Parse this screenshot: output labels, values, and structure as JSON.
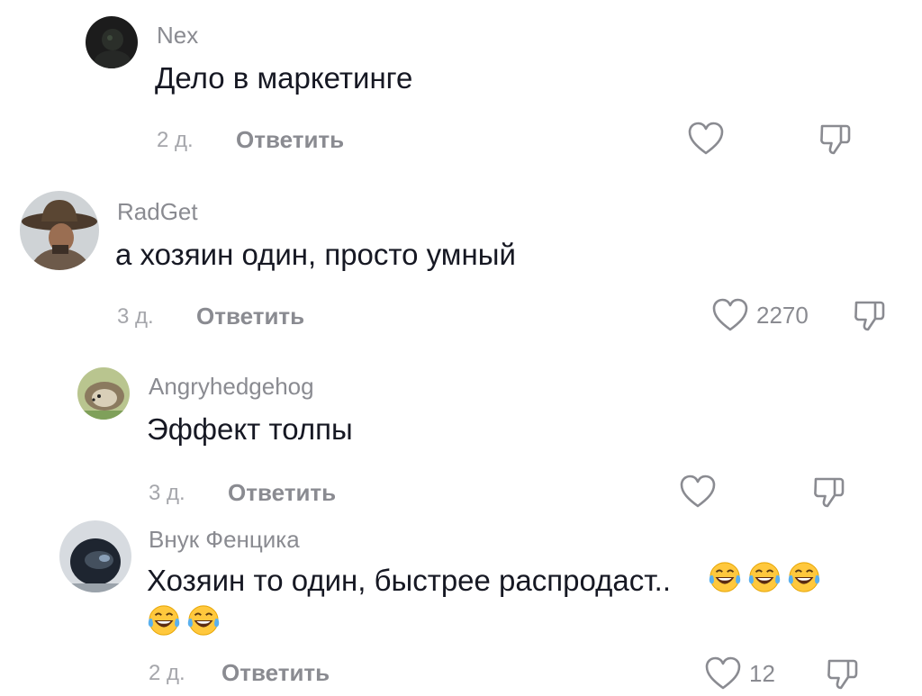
{
  "comments": [
    {
      "username": "Nex",
      "text": "Дело в маркетинге",
      "time": "2 д.",
      "reply_label": "Ответить",
      "likes": "",
      "avatar": "dark-avatar"
    },
    {
      "username": "RadGet",
      "text": "а хозяин один, просто умный",
      "time": "3 д.",
      "reply_label": "Ответить",
      "likes": "2270",
      "avatar": "cowboy-hat-avatar"
    },
    {
      "username": "Angryhedgehog",
      "text": "Эффект толпы",
      "time": "3 д.",
      "reply_label": "Ответить",
      "likes": "",
      "avatar": "hedgehog-avatar"
    },
    {
      "username": "Внук Фенцика",
      "text": "Хозяин то один, быстрее распродаст..",
      "emoji_count": 5,
      "emoji": "tears-of-joy",
      "time": "2 д.",
      "reply_label": "Ответить",
      "likes": "12",
      "avatar": "helmet-avatar"
    }
  ],
  "colors": {
    "text": "#161823",
    "secondary": "#8a8b91",
    "time": "#a5a6ab",
    "icon": "#8a8b91"
  }
}
